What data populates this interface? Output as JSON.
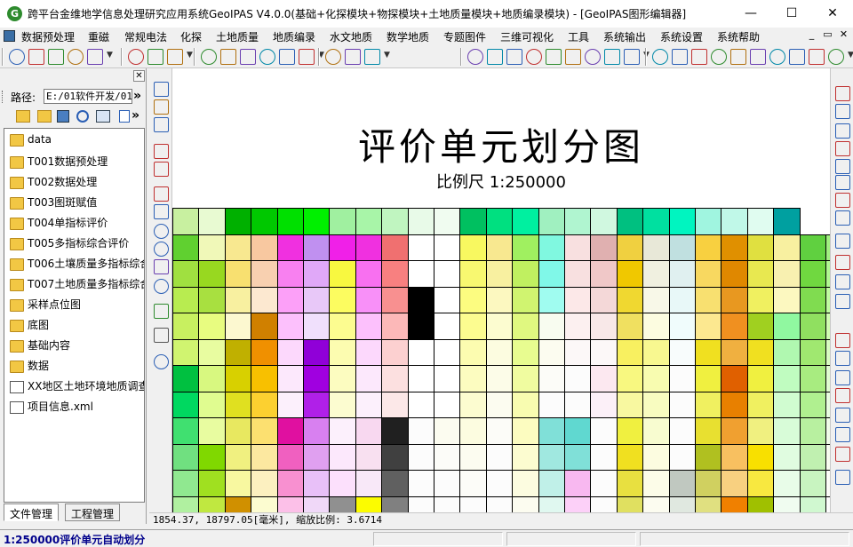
{
  "window": {
    "title": "跨平台金维地学信息处理研究应用系统GeoIPAS V4.0.0(基础+化探模块+物探模块+土地质量模块+地质编录模块) - [GeoIPAS图形编辑器]",
    "app_icon": "G",
    "minimize": "—",
    "maximize": "☐",
    "close": "✕"
  },
  "menu": [
    "数据预处理",
    "重磁",
    "常规电法",
    "化探",
    "土地质量",
    "地质编录",
    "水文地质",
    "数学地质",
    "专题图件",
    "三维可视化",
    "工具",
    "系统输出",
    "系统设置",
    "系统帮助"
  ],
  "menu_right": [
    "_",
    "▭",
    "✕"
  ],
  "left_panel": {
    "close_glyph": "✕",
    "path_label": "路径:",
    "path_value": "E:/01软件开发/01",
    "path_go": "»",
    "items": [
      {
        "label": "data",
        "type": "folder"
      },
      {
        "label": "T001数据预处理",
        "type": "folder"
      },
      {
        "label": "T002数据处理",
        "type": "folder"
      },
      {
        "label": "T003图斑赋值",
        "type": "folder"
      },
      {
        "label": "T004单指标评价",
        "type": "folder"
      },
      {
        "label": "T005多指标综合评价",
        "type": "folder"
      },
      {
        "label": "T006土壤质量多指标综合",
        "type": "folder"
      },
      {
        "label": "T007土地质量多指标综合",
        "type": "folder"
      },
      {
        "label": "采样点位图",
        "type": "folder"
      },
      {
        "label": "底图",
        "type": "folder"
      },
      {
        "label": "基础内容",
        "type": "folder"
      },
      {
        "label": "数据",
        "type": "folder"
      },
      {
        "label": "XX地区土地环境地质调查",
        "type": "file"
      },
      {
        "label": "项目信息.xml",
        "type": "file"
      }
    ],
    "tabs": [
      "文件管理",
      "工程管理"
    ]
  },
  "map": {
    "title": "评价单元划分图",
    "scale": "比例尺 1:250000"
  },
  "grid_colors": [
    [
      "#c8f0a0",
      "#e8fad2",
      "#00b000",
      "#00c800",
      "#00e000",
      "#00f000",
      "#a0f0a0",
      "#a8f5a8",
      "#c0f5c0",
      "#e8fae8",
      "#f0fcf0",
      "#00c060",
      "#00e080",
      "#00f0a0",
      "#a0f0c0",
      "#b0f5d0",
      "#d0f8e0",
      "#00c080",
      "#00e0a0",
      "#00f5c0",
      "#a0f5e0",
      "#c0f8e8",
      "#e0fcf0",
      "#00a0a0"
    ],
    [
      "#60d030",
      "#f0f8b8",
      "#f8e890",
      "#f8c8a0",
      "#f030e0",
      "#c090f0",
      "#f020e8",
      "#f030e0",
      "#f07070",
      "#ffffff",
      "#ffffff",
      "#f8f860",
      "#f8e890",
      "#a0f060",
      "#80f8e0",
      "#f8e0e0",
      "#e0b0b0",
      "#f0d040",
      "#e8e8d8",
      "#c0e0e0",
      "#f8d040",
      "#e09000",
      "#e0e040",
      "#f8f0a0",
      "#60d040",
      "#a0f080"
    ],
    [
      "#a0e040",
      "#98d820",
      "#f8e070",
      "#f8d0b0",
      "#f880f0",
      "#e0a8f8",
      "#f8f840",
      "#f870f0",
      "#f88080",
      "#ffffff",
      "#ffffff",
      "#f8f870",
      "#f8f0a0",
      "#c0f060",
      "#80f8e8",
      "#f8e0e0",
      "#f0c8c8",
      "#f0c800",
      "#f0f0e0",
      "#e0f0f0",
      "#f8d860",
      "#e08800",
      "#e8e850",
      "#f8f0b0",
      "#70d840",
      "#b0f890"
    ],
    [
      "#b8ec50",
      "#a8e040",
      "#f8f0a0",
      "#fce8d0",
      "#fca0f8",
      "#e8c8f8",
      "#fcfc60",
      "#f890f8",
      "#f89090",
      "#000000",
      "#ffffff",
      "#fcfc80",
      "#fcf8c0",
      "#d0f470",
      "#a0fcf0",
      "#fce8e8",
      "#f4d8d8",
      "#f0d830",
      "#f8f8e8",
      "#e8f8f8",
      "#f8e070",
      "#e89820",
      "#f0f060",
      "#fcf8c0",
      "#80dc50",
      "#c0fca0"
    ],
    [
      "#c8f060",
      "#e8fc80",
      "#fcf8d0",
      "#d08000",
      "#fcc0fc",
      "#f0e0fc",
      "#fcfc90",
      "#fcc0fc",
      "#fcb8b8",
      "#000000",
      "#ffffff",
      "#fcfc90",
      "#fcfcd0",
      "#e0f880",
      "#f8fcf0",
      "#fcf0f0",
      "#f8e8e8",
      "#f0e060",
      "#fcfce0",
      "#f0fcfc",
      "#fce890",
      "#f09020",
      "#a0d020",
      "#90f8a0",
      "#90e060",
      "#d0fcb0"
    ],
    [
      "#d0f470",
      "#e8fca0",
      "#c0b000",
      "#f09000",
      "#fcd8fc",
      "#9000d8",
      "#fcfcb0",
      "#fcd8fc",
      "#fcd0d0",
      "#ffffff",
      "#ffffff",
      "#fcfcb0",
      "#fcfce0",
      "#e8fc90",
      "#fcfcf0",
      "#fcf8f8",
      "#fcf8f8",
      "#f8f060",
      "#f8f890",
      "#f8fcfc",
      "#f0e020",
      "#f0b040",
      "#f0e020",
      "#b0f8b0",
      "#a0e870",
      "#d8fcc0"
    ],
    [
      "#00c040",
      "#d8f880",
      "#d8d000",
      "#f8c000",
      "#fce8fc",
      "#a000e0",
      "#fcfcc0",
      "#fce8fc",
      "#fce0e0",
      "#ffffff",
      "#ffffff",
      "#fcfcc0",
      "#fcfce8",
      "#f0fca0",
      "#fcfcf8",
      "#fcfcfc",
      "#fce8f0",
      "#f8f880",
      "#f8fcb0",
      "#fcfcfc",
      "#f0f040",
      "#e06000",
      "#f0f040",
      "#c0fcc0",
      "#a8ec80",
      "#e0fcd0"
    ],
    [
      "#00d860",
      "#e0fc90",
      "#e0e020",
      "#fcd030",
      "#fcf0fc",
      "#b020e8",
      "#fcfcd0",
      "#fcf0fc",
      "#fce8e8",
      "#ffffff",
      "#ffffff",
      "#fcfcd0",
      "#fcfcf0",
      "#f8fcb0",
      "#fcfcfc",
      "#fcfcfc",
      "#fcf0f8",
      "#f8f8a0",
      "#f8fcc0",
      "#fcfcfc",
      "#f0f060",
      "#e88000",
      "#f0f060",
      "#d0fcd0",
      "#b0f090",
      "#e8fce0"
    ],
    [
      "#40e070",
      "#e8fca0",
      "#e8e860",
      "#fce070",
      "#e010a0",
      "#d880f0",
      "#fcf0fc",
      "#f8d8f0",
      "#202020",
      "#fcfcfc",
      "#fcfcf0",
      "#fcfce0",
      "#fcfcf8",
      "#fcfcc0",
      "#80e0d8",
      "#60d8d0",
      "#fcfcfc",
      "#f0f040",
      "#f8fcd0",
      "#fcfcfc",
      "#e8e030",
      "#f0a030",
      "#f0f080",
      "#d8fcd8",
      "#b8f0a0",
      "#f0fce8"
    ],
    [
      "#70e080",
      "#80d800",
      "#f0f080",
      "#fce8a0",
      "#f060c0",
      "#e0a0f0",
      "#fce8fc",
      "#f8e0f0",
      "#404040",
      "#fcfcfc",
      "#fcfcf8",
      "#fcfcf0",
      "#fcfcfc",
      "#fcfcd0",
      "#a0e8e0",
      "#80e0d8",
      "#fcfcfc",
      "#f0e020",
      "#fcfce0",
      "#fcfcfc",
      "#b0c020",
      "#f8c060",
      "#f8e000",
      "#e0fce0",
      "#c0f0b0",
      "#f8fcf0"
    ],
    [
      "#90e890",
      "#a0e020",
      "#f8f8a0",
      "#fcf0c0",
      "#f890d0",
      "#e8c0f8",
      "#fce0fc",
      "#f8e8f8",
      "#606060",
      "#fcfcfc",
      "#fcfcfc",
      "#fcfcf8",
      "#fcfcfc",
      "#fcfce0",
      "#c0f0e8",
      "#f8b8f0",
      "#fcfcfc",
      "#e8e040",
      "#fcfce8",
      "#c0c8c0",
      "#d0d060",
      "#f8d080",
      "#f8e840",
      "#e8fce8",
      "#c8f4c0",
      "#fcfcf8"
    ],
    [
      "#b0f0a0",
      "#c0e840",
      "#d09000",
      "#fcfcd0",
      "#fcc0e8",
      "#f0d8f8",
      "#909090",
      "#fcfc00",
      "#808080",
      "#fcfcfc",
      "#fcfcfc",
      "#fcfcfc",
      "#fcfcfc",
      "#fcfcf0",
      "#e0f8f0",
      "#fcd0f8",
      "#fcfcfc",
      "#e0e060",
      "#fcfcf0",
      "#e0e8e0",
      "#e0e080",
      "#f08000",
      "#a0c000",
      "#f0fcf0",
      "#d0f8d0",
      "#fcfcfc"
    ]
  ],
  "coord_text": "1854.37, 18797.05[毫米], 缩放比例: 3.6714",
  "status_text": "1:250000评价单元自动划分"
}
